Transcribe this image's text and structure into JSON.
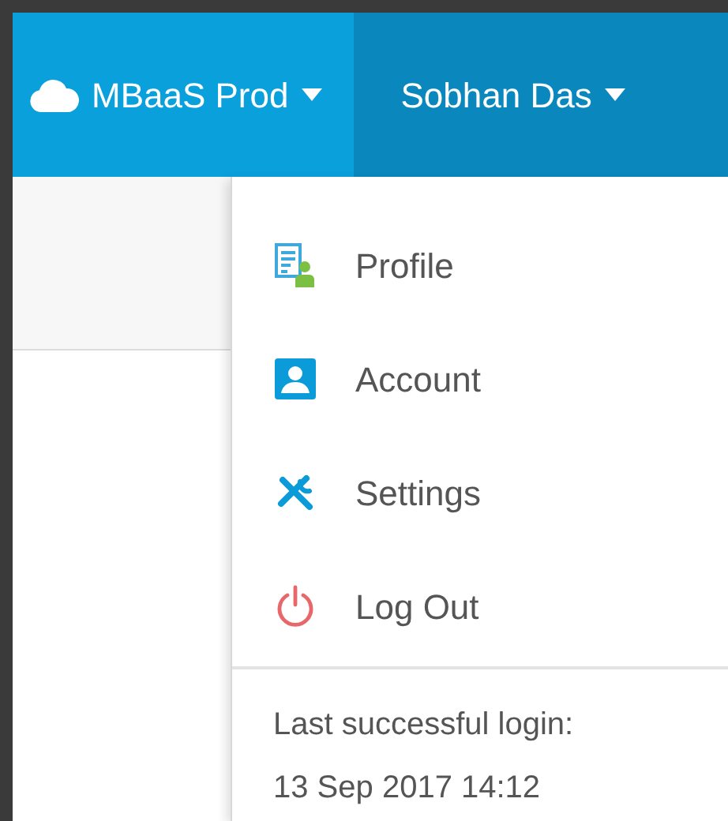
{
  "navbar": {
    "items": [
      {
        "kind": "cloud",
        "label": "MBaaS Prod",
        "selected": false
      },
      {
        "kind": "user",
        "label": "Sobhan Das",
        "selected": true
      }
    ]
  },
  "user_menu": {
    "items": [
      {
        "kind": "profile",
        "label": "Profile"
      },
      {
        "kind": "account",
        "label": "Account"
      },
      {
        "kind": "settings",
        "label": "Settings"
      },
      {
        "kind": "logout",
        "label": "Log Out"
      }
    ],
    "footer": [
      "Last successful login:",
      "13 Sep 2017 14:12"
    ]
  }
}
